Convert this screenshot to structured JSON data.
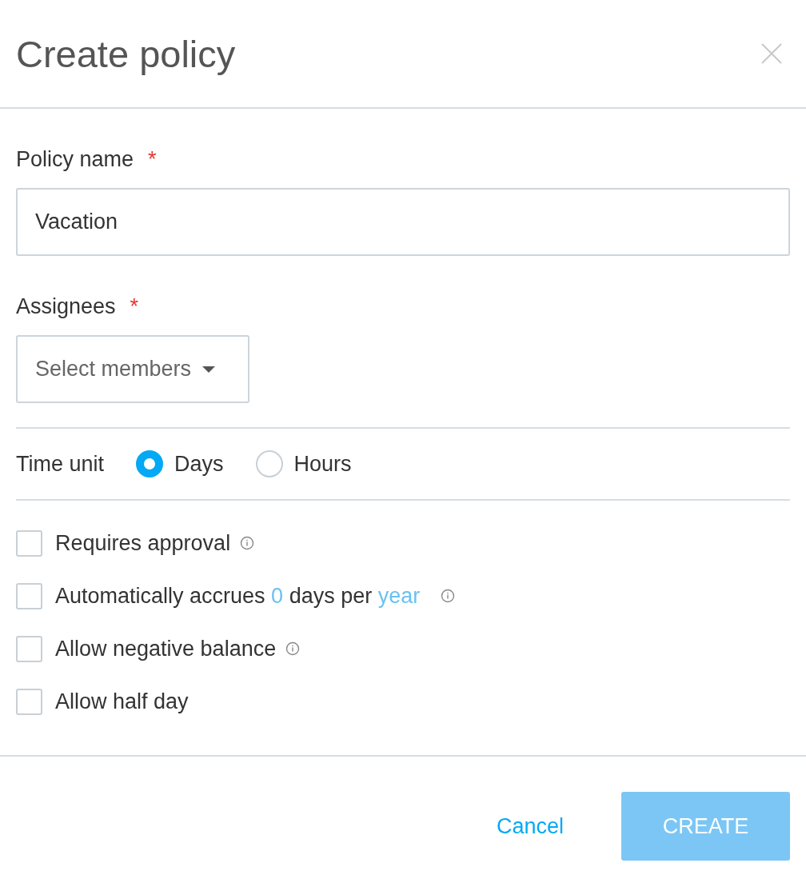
{
  "dialog": {
    "title": "Create policy"
  },
  "fields": [
    {
      "kind": "text",
      "label": "Policy name",
      "required_mark": "*",
      "value": "Vacation"
    },
    {
      "kind": "dropdown",
      "label": "Assignees",
      "required_mark": "*",
      "placeholder": "Select members"
    }
  ],
  "time_unit": {
    "label": "Time unit",
    "options": [
      {
        "label": "Days",
        "selected": true
      },
      {
        "label": "Hours",
        "selected": false
      }
    ]
  },
  "options": [
    {
      "checked": false,
      "info": true,
      "parts": [
        {
          "kind": "text",
          "text": "Requires approval"
        }
      ]
    },
    {
      "checked": false,
      "info": true,
      "parts": [
        {
          "kind": "text",
          "text": "Automatically accrues "
        },
        {
          "kind": "link",
          "text": "0"
        },
        {
          "kind": "text",
          "text": " days per "
        },
        {
          "kind": "link",
          "text": "year"
        }
      ]
    },
    {
      "checked": false,
      "info": true,
      "parts": [
        {
          "kind": "text",
          "text": "Allow negative balance"
        }
      ]
    },
    {
      "checked": false,
      "info": false,
      "parts": [
        {
          "kind": "text",
          "text": "Allow half day"
        }
      ]
    }
  ],
  "footer": {
    "cancel": "Cancel",
    "submit": "CREATE",
    "submit_disabled": true
  }
}
